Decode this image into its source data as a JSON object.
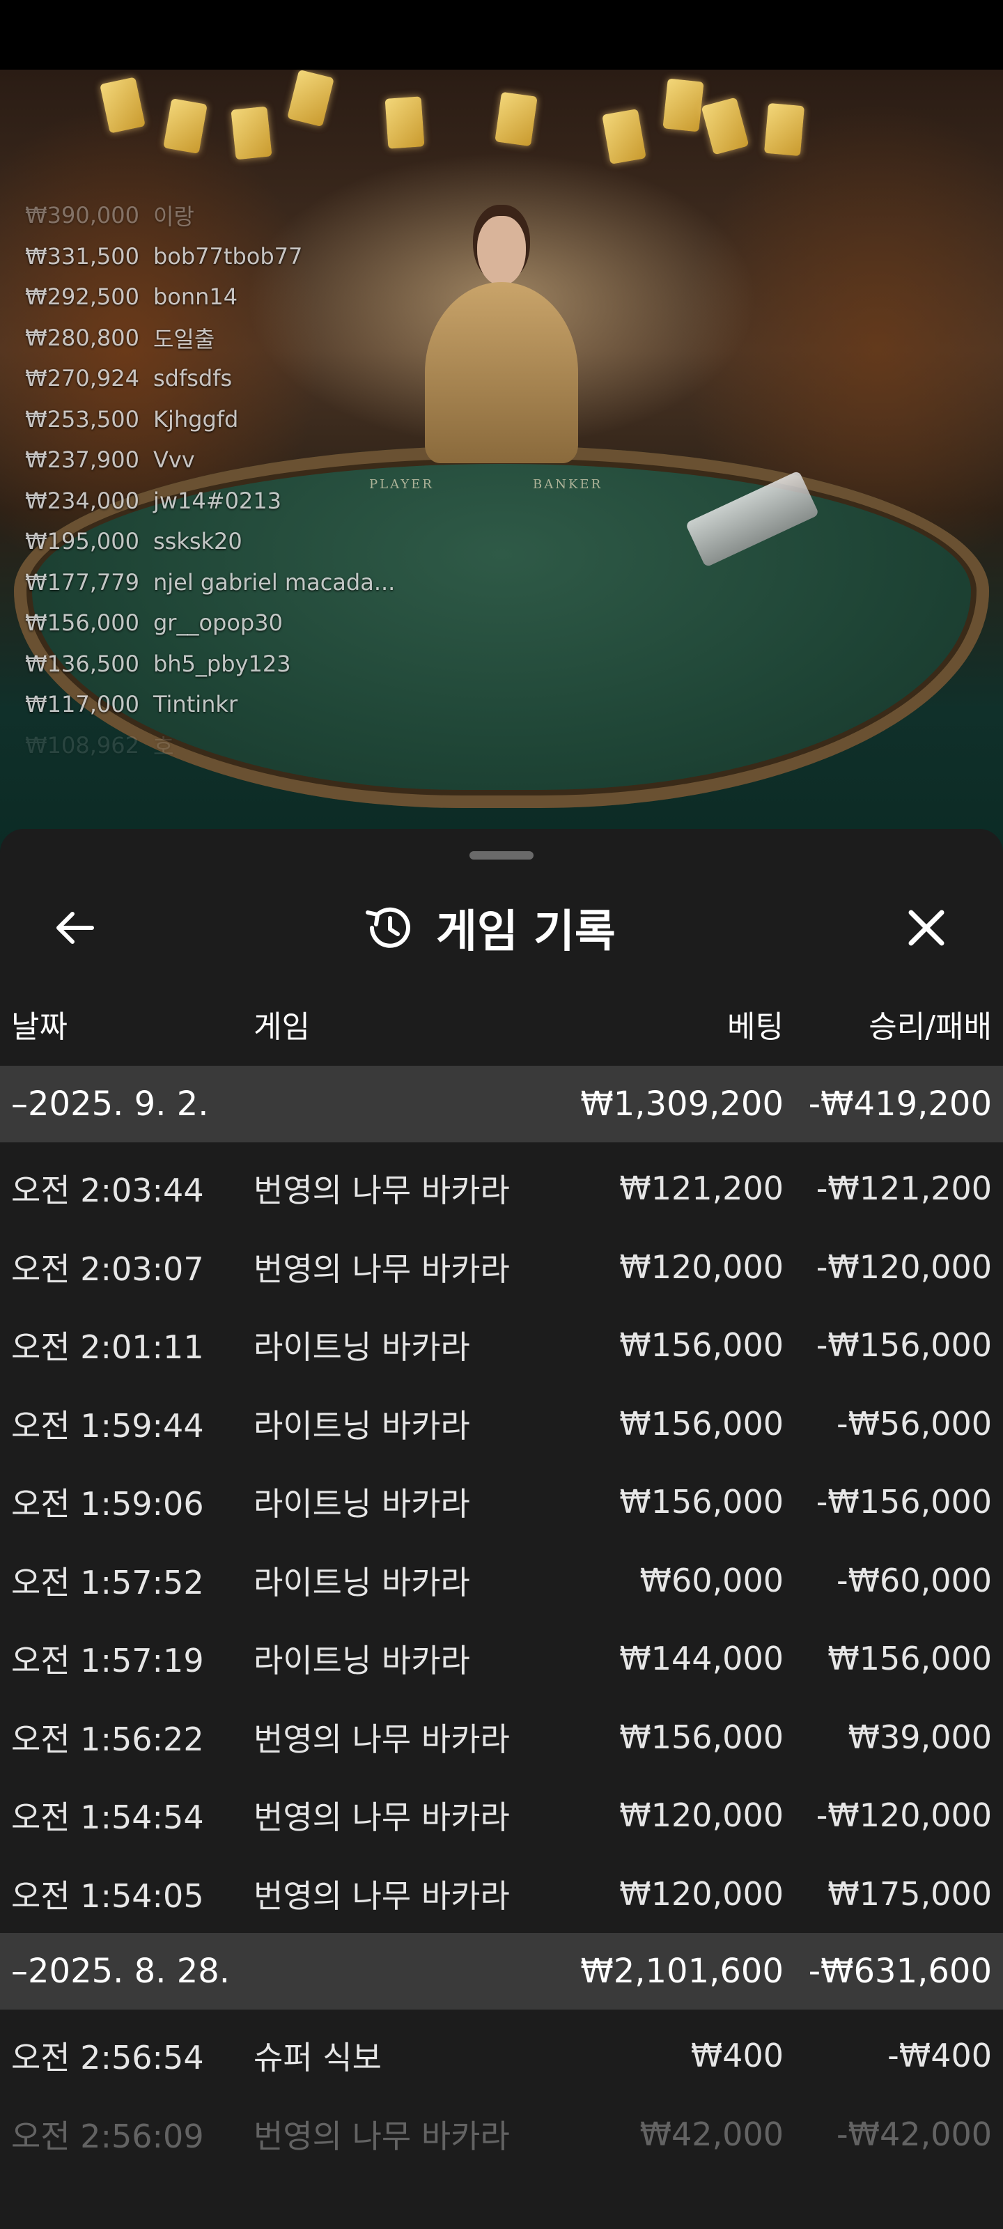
{
  "leaderboard": [
    {
      "amount": "₩390,000",
      "name": "이랑"
    },
    {
      "amount": "₩331,500",
      "name": "bob77tbob77"
    },
    {
      "amount": "₩292,500",
      "name": "bonn14"
    },
    {
      "amount": "₩280,800",
      "name": "도일출"
    },
    {
      "amount": "₩270,924",
      "name": "sdfsdfs"
    },
    {
      "amount": "₩253,500",
      "name": "Kjhggfd"
    },
    {
      "amount": "₩237,900",
      "name": "Vvv"
    },
    {
      "amount": "₩234,000",
      "name": "jw14#0213"
    },
    {
      "amount": "₩195,000",
      "name": "ssksk20"
    },
    {
      "amount": "₩177,779",
      "name": "njel gabriel macada..."
    },
    {
      "amount": "₩156,000",
      "name": "gr__opop30"
    },
    {
      "amount": "₩136,500",
      "name": "bh5_pby123"
    },
    {
      "amount": "₩117,000",
      "name": "Tintinkr"
    },
    {
      "amount": "₩108,962",
      "name": "호"
    }
  ],
  "table": {
    "player_label": "PLAYER",
    "banker_label": "BANKER"
  },
  "panel": {
    "title": "게임 기록",
    "icons": {
      "back": "arrow-left-icon",
      "history": "history-icon",
      "close": "close-icon"
    },
    "columns": {
      "date": "날짜",
      "game": "게임",
      "bet": "베팅",
      "win_loss": "승리/패배"
    },
    "groups": [
      {
        "date": "–2025. 9. 2.",
        "bet": "₩1,309,200",
        "win_loss": "-₩419,200",
        "rows": [
          {
            "time": "오전 2:03:44",
            "game": "번영의 나무 바카라",
            "bet": "₩121,200",
            "win_loss": "-₩121,200"
          },
          {
            "time": "오전 2:03:07",
            "game": "번영의 나무 바카라",
            "bet": "₩120,000",
            "win_loss": "-₩120,000"
          },
          {
            "time": "오전 2:01:11",
            "game": "라이트닝 바카라",
            "bet": "₩156,000",
            "win_loss": "-₩156,000"
          },
          {
            "time": "오전 1:59:44",
            "game": "라이트닝 바카라",
            "bet": "₩156,000",
            "win_loss": "-₩56,000"
          },
          {
            "time": "오전 1:59:06",
            "game": "라이트닝 바카라",
            "bet": "₩156,000",
            "win_loss": "-₩156,000"
          },
          {
            "time": "오전 1:57:52",
            "game": "라이트닝 바카라",
            "bet": "₩60,000",
            "win_loss": "-₩60,000"
          },
          {
            "time": "오전 1:57:19",
            "game": "라이트닝 바카라",
            "bet": "₩144,000",
            "win_loss": "₩156,000"
          },
          {
            "time": "오전 1:56:22",
            "game": "번영의 나무 바카라",
            "bet": "₩156,000",
            "win_loss": "₩39,000"
          },
          {
            "time": "오전 1:54:54",
            "game": "번영의 나무 바카라",
            "bet": "₩120,000",
            "win_loss": "-₩120,000"
          },
          {
            "time": "오전 1:54:05",
            "game": "번영의 나무 바카라",
            "bet": "₩120,000",
            "win_loss": "₩175,000"
          }
        ]
      },
      {
        "date": "–2025. 8. 28.",
        "bet": "₩2,101,600",
        "win_loss": "-₩631,600",
        "rows": [
          {
            "time": "오전 2:56:54",
            "game": "슈퍼 식보",
            "bet": "₩400",
            "win_loss": "-₩400"
          },
          {
            "time": "오전 2:56:09",
            "game": "번영의 나무 바카라",
            "bet": "₩42,000",
            "win_loss": "-₩42,000"
          }
        ]
      }
    ]
  }
}
